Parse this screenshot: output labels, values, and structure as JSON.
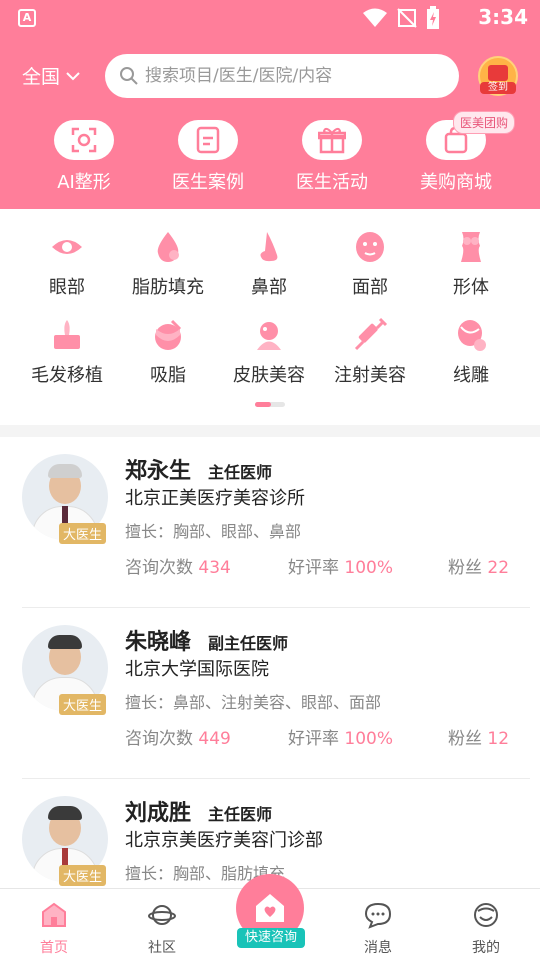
{
  "status_bar": {
    "app_badge": "A",
    "time": "3:34"
  },
  "header": {
    "region": "全国",
    "search_placeholder": "搜索项目/医生/医院/内容",
    "checkin_label": "签到"
  },
  "quick_entries": [
    {
      "label": "AI整形",
      "icon": "ai-face-scan-icon"
    },
    {
      "label": "医生案例",
      "icon": "case-book-icon"
    },
    {
      "label": "医生活动",
      "icon": "gift-icon"
    },
    {
      "label": "美购商城",
      "icon": "shopping-bag-icon"
    }
  ],
  "quick_badge": "医美团购",
  "categories": [
    {
      "label": "眼部",
      "icon": "eye-icon"
    },
    {
      "label": "脂肪填充",
      "icon": "fat-drop-icon"
    },
    {
      "label": "鼻部",
      "icon": "nose-icon"
    },
    {
      "label": "面部",
      "icon": "face-icon"
    },
    {
      "label": "形体",
      "icon": "body-icon"
    },
    {
      "label": "毛发移植",
      "icon": "hair-icon"
    },
    {
      "label": "吸脂",
      "icon": "liposuction-icon"
    },
    {
      "label": "皮肤美容",
      "icon": "skin-icon"
    },
    {
      "label": "注射美容",
      "icon": "syringe-icon"
    },
    {
      "label": "线雕",
      "icon": "thread-lift-icon"
    }
  ],
  "doctors": [
    {
      "name": "郑永生",
      "title": "主任医师",
      "tag": "大医生",
      "hospital": "北京正美医疗美容诊所",
      "specialty": "擅长：胸部、眼部、鼻部",
      "consult_label": "咨询次数",
      "consult_count": "434",
      "rating_label": "好评率",
      "rating": "100%",
      "fans_label": "粉丝",
      "fans": "22"
    },
    {
      "name": "朱晓峰",
      "title": "副主任医师",
      "tag": "大医生",
      "hospital": "北京大学国际医院",
      "specialty": "擅长：鼻部、注射美容、眼部、面部",
      "consult_label": "咨询次数",
      "consult_count": "449",
      "rating_label": "好评率",
      "rating": "100%",
      "fans_label": "粉丝",
      "fans": "12"
    },
    {
      "name": "刘成胜",
      "title": "主任医师",
      "tag": "大医生",
      "hospital": "北京京美医疗美容门诊部",
      "specialty": "擅长：胸部、脂肪填充",
      "consult_label": "",
      "consult_count": "",
      "rating_label": "",
      "rating": "",
      "fans_label": "",
      "fans": ""
    }
  ],
  "bottom_nav": {
    "home": "首页",
    "community": "社区",
    "quick_consult": "快速咨询",
    "messages": "消息",
    "mine": "我的"
  },
  "colors": {
    "brand_pink": "#ff7e9a",
    "badge_gold": "#e2b765",
    "consult_teal": "#19c3b8"
  }
}
